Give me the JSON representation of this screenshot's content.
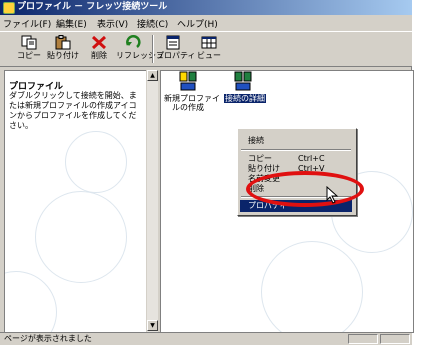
{
  "window": {
    "title": "プロファイル － フレッツ接続ツール"
  },
  "menu": [
    "ファイル(F)",
    "編集(E)",
    "表示(V)",
    "接続(C)",
    "ヘルプ(H)"
  ],
  "toolbar": {
    "copy": "コピー",
    "paste": "貼り付け",
    "delete": "削除",
    "refresh": "リフレッシュ",
    "properties": "プロパティ",
    "view": "ビュー"
  },
  "left_pane": {
    "title": "プロファイル",
    "description": "ダブルクリックして接続を開始、または新規プロファイルの作成アイコンからプロファイルを作成してください。"
  },
  "items": [
    {
      "label": "新規プロファイルの作成",
      "selected": false
    },
    {
      "label": "接続の詳細",
      "selected": true
    }
  ],
  "context_menu": {
    "connect": "接続",
    "copy": "コピー",
    "copy_shortcut": "Ctrl+C",
    "paste": "貼り付け",
    "paste_shortcut": "Ctrl+V",
    "rename": "名前変更",
    "delete": "削除",
    "properties": "プロパティ"
  },
  "status": {
    "text": "ページが表示されました"
  },
  "colors": {
    "highlight": "#0a246a",
    "annotation": "#e01010"
  }
}
